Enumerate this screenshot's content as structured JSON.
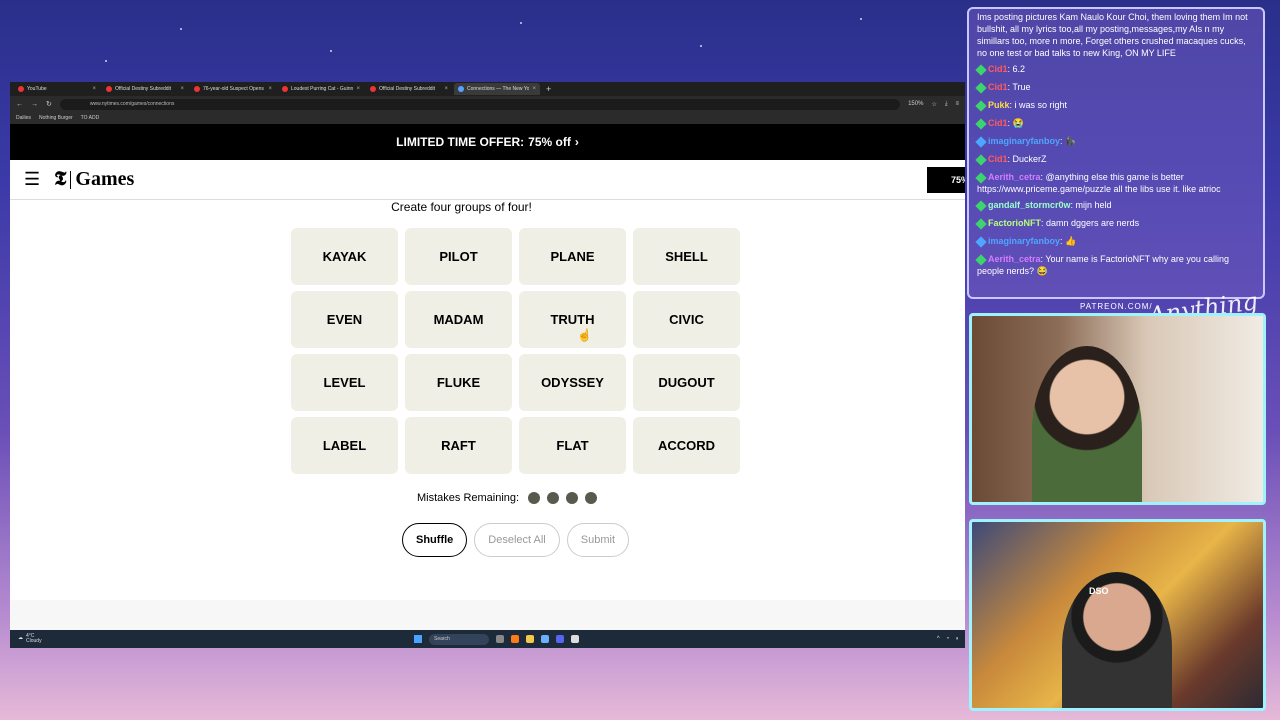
{
  "browser": {
    "tabs": [
      {
        "label": "YouTube",
        "active": false
      },
      {
        "label": "Official Destiny Subreddit",
        "active": false
      },
      {
        "label": "76-year-old Suspect Opens Fir",
        "active": false
      },
      {
        "label": "Loudest Purring Cat - Guinness",
        "active": false
      },
      {
        "label": "Official Destiny Subreddit",
        "active": false
      },
      {
        "label": "Connections — The New York T",
        "active": true
      }
    ],
    "new_tab": "+",
    "url": "www.nytimes.com/games/connections",
    "zoom": "150%",
    "bookmarks": [
      "Dailies",
      "Nothing Burger",
      "TO ADD"
    ]
  },
  "offer_banner": {
    "text": "LIMITED TIME OFFER:",
    "highlight": "75% off",
    "arrow": "›"
  },
  "header": {
    "logo_text": "Games",
    "logo_mark": "𝕿",
    "subscribe_partial": "75%"
  },
  "game": {
    "prompt": "Create four groups of four!",
    "tiles": [
      "KAYAK",
      "PILOT",
      "PLANE",
      "SHELL",
      "EVEN",
      "MADAM",
      "TRUTH",
      "CIVIC",
      "LEVEL",
      "FLUKE",
      "ODYSSEY",
      "DUGOUT",
      "LABEL",
      "RAFT",
      "FLAT",
      "ACCORD"
    ],
    "mistakes_label": "Mistakes Remaining:",
    "mistakes_remaining": 4,
    "buttons": {
      "shuffle": "Shuffle",
      "deselect": "Deselect All",
      "submit": "Submit"
    }
  },
  "taskbar": {
    "temp": "4°C",
    "weather": "Cloudy",
    "search": "Search"
  },
  "chat": {
    "messages": [
      {
        "user": "",
        "text": "Ims posting pictures Kam Naulo Kour Choi, them loving them Im not bullshit, all my lyrics too,all my posting,messages,my AIs n my simillars too, more n more, Forget others crushed macaques cucks, no one test or bad talks to new King, ON MY LIFE",
        "color": "#ffffff"
      },
      {
        "user": "Cid1",
        "text": "6.2",
        "color": "#ff5a5a"
      },
      {
        "user": "Cid1",
        "text": "True",
        "color": "#ff5a5a"
      },
      {
        "user": "Pukk",
        "text": "i was so right",
        "color": "#ffd84a"
      },
      {
        "user": "Cid1",
        "text": "😭",
        "color": "#ff5a5a"
      },
      {
        "user": "imaginaryfanboy",
        "text": "🦍",
        "color": "#4da6ff"
      },
      {
        "user": "Cid1",
        "text": "DuckerZ",
        "color": "#ff5a5a"
      },
      {
        "user": "Aerith_cetra",
        "text": "@anything else this game is better https://www.priceme.game/puzzle all the libs use it. like atrioc",
        "color": "#d47cff"
      },
      {
        "user": "gandalf_stormcr0w",
        "text": "mijn held",
        "color": "#9affc8"
      },
      {
        "user": "FactorioNFT",
        "text": "damn dggers are nerds",
        "color": "#b8ff7a"
      },
      {
        "user": "imaginaryfanboy",
        "text": "👍",
        "color": "#4da6ff"
      },
      {
        "user": "Aerith_cetra",
        "text": "Your name is FactorioNFT why are you calling people nerds? 😂",
        "color": "#d47cff"
      }
    ]
  },
  "overlay": {
    "patreon": "PATREON.COM/",
    "brand": "Anything Else?",
    "cap_text": "DSO"
  }
}
